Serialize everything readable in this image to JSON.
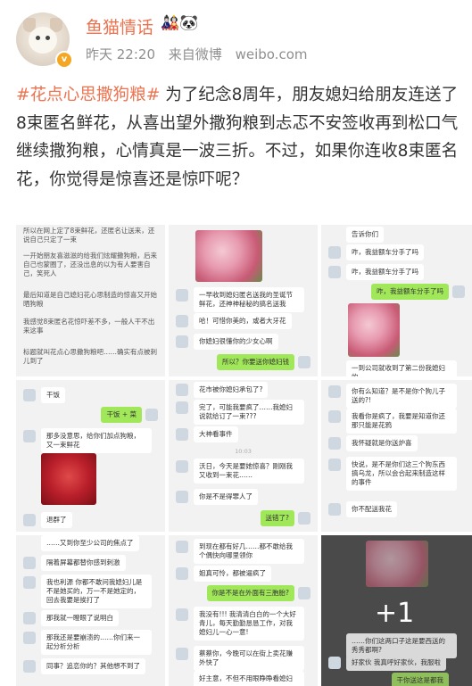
{
  "author": {
    "name": "鱼猫情话",
    "badges": "🎎🐼",
    "verified_mark": "v"
  },
  "meta": {
    "time": "昨天 22:20",
    "source": "来自微博",
    "site": "weibo.com"
  },
  "post": {
    "hashtag": "#花点心思撒狗粮#",
    "body": " 为了纪念8周年，朋友媳妇给朋友连送了8束匿名鲜花，从喜出望外撒狗粮到忐忑不安签收再到松口气继续撒狗粮，心情真是一波三折。不过，如果你连收8束匿名花，你觉得是惊喜还是惊吓呢？"
  },
  "images": {
    "img1": {
      "lines": [
        "所以在网上定了8束鲜花，还匿名让送来，还说自己只定了一束",
        "一开始朋友喜滋滋的给我们炫耀撒狗粮，后来自己也蒙圈了，还没出息的以为有人要害自己，笑死人",
        "最后知道是自己媳妇花心思制造的惊喜又开始晒狗粮",
        "我感觉8束匿名花惊吓差不多，一般人干不出来这事",
        "标题就叫花点心思撒狗粮吧……确实有点被刺儿到了"
      ]
    },
    "img2": {
      "bubbles": [
        "一早收到媳妇匿名送我的圣诞节鲜花，还神神秘秘的搞名送我",
        "哈！可惜你美的，或者大牙花",
        "你媳妇很懂你的少女心啊",
        "所以？你要送你媳妇钱"
      ]
    },
    "img3": {
      "bubbles": [
        "告诉你们",
        "咋，我益额车分手了吗",
        "咋，我益额车分手了吗",
        "咋，我益额车分手了吗",
        "一到公司就收到了第二份我媳妇的"
      ]
    },
    "img4": {
      "bubbles": [
        "干饭",
        "干饭 + 菜",
        "那多没意思，给你们加点狗粮，又一束鲜花",
        "退群了"
      ]
    },
    "img5": {
      "bubbles": [
        "花市被你媳妇承包了?",
        "完了，可能我要疯了……我媳妇说就给订了一束???",
        "大神看事件",
        "10:03",
        "沃日，今天是要她惊喜？刚刚我又收到一束花……",
        "你是不是得罪人了",
        "送错了?"
      ]
    },
    "img6": {
      "bubbles": [
        "你有么知道？是不是你个狗儿子送的?!",
        "我看你是疯了，我要是知道你还那只能是花鸦",
        "我怀疑就是你送炉喜",
        "快说，是不是你们这三个狗东西搞乌龙，所以会合起来制造这样的事件",
        "你不配送我花"
      ]
    },
    "img7": {
      "bubbles": [
        "……又到你至少公司的焦点了",
        "隔着屏幕都替你感到刺激",
        "我也利源 你都不敢问我媳妇儿是不是她买的，万一不是她定的，回去我要是挨打了",
        "那我就一瞪眼了说明白",
        "那我还是要崩溃的……你们来一起分析分析",
        "同事？追恋你的？其他想不到了"
      ]
    },
    "img8": {
      "bubbles": [
        "到现在都有好几……都不敢给我个偶快向哪里领你",
        "姐真可怜，都被逼疯了",
        "你是不是在外面有三胞胎?",
        "我没有!!! 我清清白白的一个大好青儿，每天勤勤恳恳工作，对我媳妇儿一心一意!",
        "蔡蔡你，今晚可以在街上卖花赚外快了",
        "好主意，不但不用眼睁睁看媳妇 …"
      ]
    },
    "img9": {
      "overlay": "+1",
      "bubbles": [
        "……你们这两口子这是要西送的秀秀都啊?",
        "好家伙  我真呼好家伙，我服啦",
        "干你送这是都我"
      ]
    }
  }
}
